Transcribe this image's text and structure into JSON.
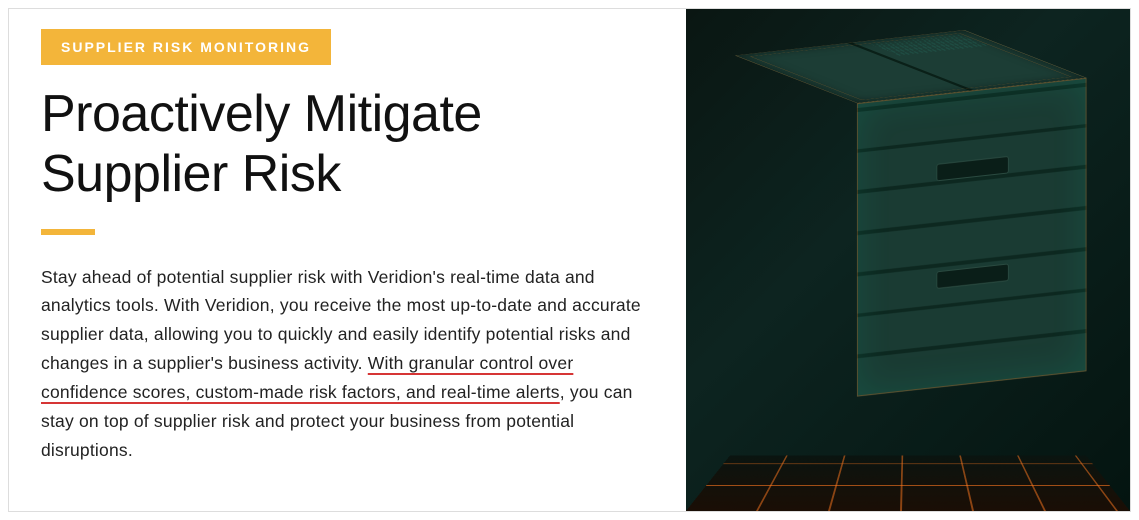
{
  "badge": "SUPPLIER RISK MONITORING",
  "headline": "Proactively Mitigate Supplier Risk",
  "body": {
    "part1": "Stay ahead of potential supplier risk with Veridion's real-time data and analytics tools. With Veridion, you receive the most up-to-date and accurate supplier data, allowing you to quickly and easily identify potential risks and changes in a supplier's business activity. ",
    "underlined": "With granular control over confidence scores, custom-made risk factors, and real-time alerts",
    "part2": ", you can stay on top of supplier risk and protect your business from potential disruptions."
  },
  "colors": {
    "accent": "#f3b53a",
    "underline": "#d63535"
  }
}
